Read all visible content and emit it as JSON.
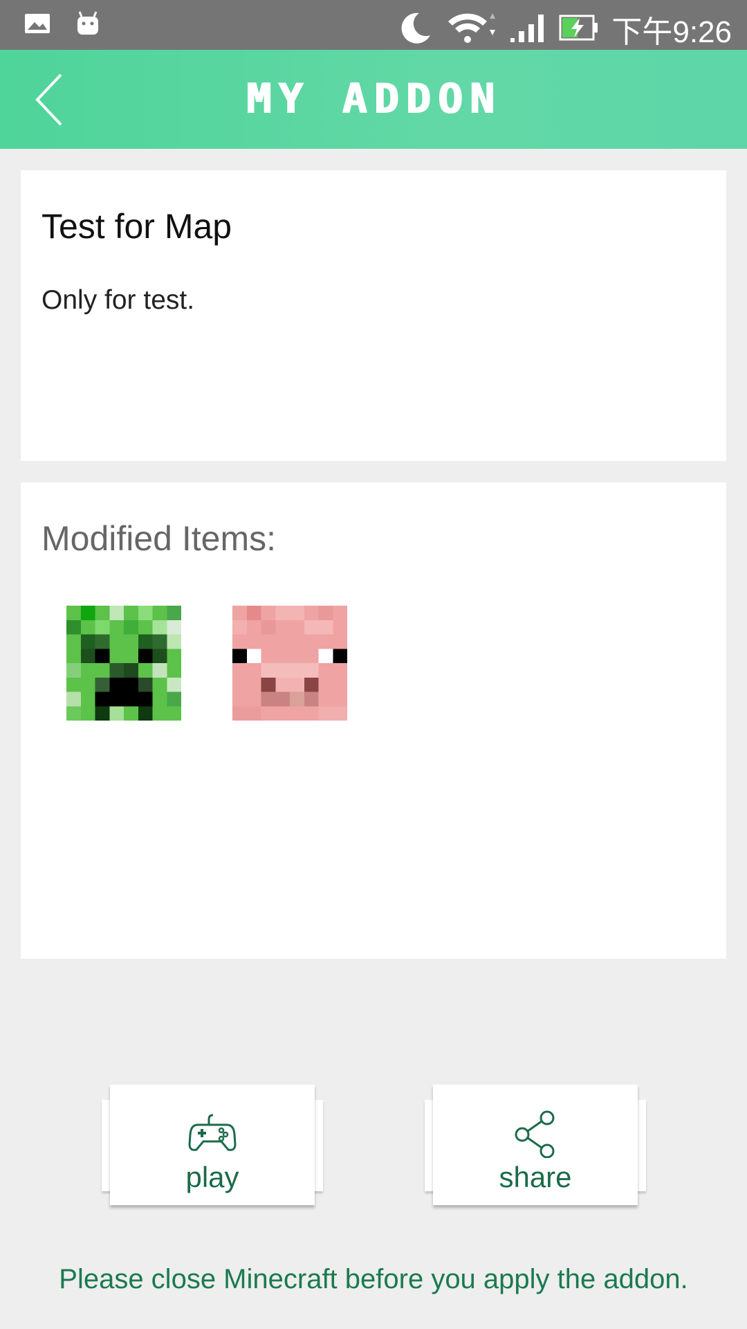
{
  "status_bar": {
    "time": "下午9:26",
    "left_icons": [
      "gallery-icon",
      "android-icon"
    ],
    "right_icons": [
      "moon-icon",
      "wifi-icon",
      "signal-icon",
      "battery-charging-icon"
    ]
  },
  "app_bar": {
    "title": "MY ADDON",
    "back_icon": "chevron-left-icon",
    "color": "#5ed6a8"
  },
  "addon": {
    "title": "Test for Map",
    "description": "Only for test."
  },
  "modified_items": {
    "heading": "Modified Items:",
    "items": [
      {
        "name": "creeper-icon"
      },
      {
        "name": "pig-icon"
      }
    ]
  },
  "actions": {
    "play_label": "play",
    "share_label": "share",
    "accent_color": "#1b6b48"
  },
  "notice": "Please close Minecraft before you apply the addon."
}
